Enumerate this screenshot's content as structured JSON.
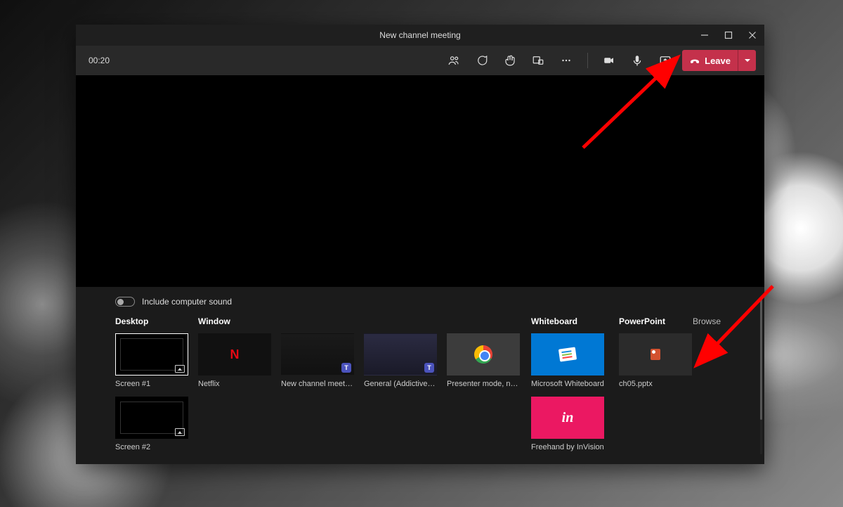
{
  "window": {
    "title": "New channel meeting"
  },
  "toolbar": {
    "timer": "00:20",
    "leave_label": "Leave"
  },
  "tray": {
    "sound_label": "Include computer sound",
    "headers": {
      "desktop": "Desktop",
      "window": "Window",
      "whiteboard": "Whiteboard",
      "powerpoint": "PowerPoint",
      "browse": "Browse"
    },
    "desktop_items": [
      {
        "label": "Screen #1"
      },
      {
        "label": "Screen #2"
      }
    ],
    "window_items": [
      {
        "label": "Netflix"
      },
      {
        "label": "New channel meeting | ..."
      },
      {
        "label": "General (AddictiveTips - ..."
      },
      {
        "label": "Presenter mode, notes a..."
      }
    ],
    "whiteboard_items": [
      {
        "label": "Microsoft Whiteboard"
      },
      {
        "label": "Freehand by InVision"
      }
    ],
    "powerpoint_items": [
      {
        "label": "ch05.pptx"
      }
    ]
  }
}
